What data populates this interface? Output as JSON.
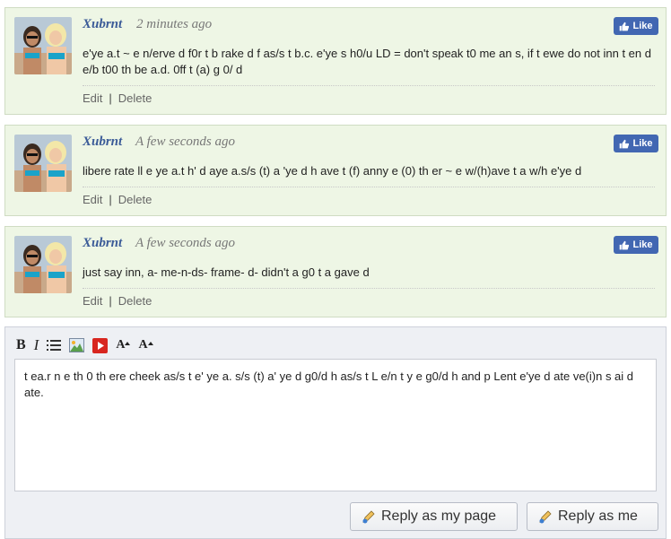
{
  "like_label": "Like",
  "edit_label": "Edit",
  "delete_label": "Delete",
  "separator": "|",
  "comments": [
    {
      "author": "Xubrnt",
      "time": "2 minutes ago",
      "text": "e'ye a.t ~ e n/erve d f0r t b rake d f as/s t b.c. e'ye s h0/u LD = don't speak t0 me an s, if t ewe do not inn t en d e/b t00 th be a.d. 0ff t (a) g 0/ d"
    },
    {
      "author": "Xubrnt",
      "time": "A few seconds ago",
      "text": "libere rate ll e ye a.t h' d aye a.s/s (t) a 'ye d h ave t (f) anny e (0) th er ~ e w/(h)ave t a w/h e'ye d"
    },
    {
      "author": "Xubrnt",
      "time": "A few seconds ago",
      "text": "just say inn, a- me-n-ds- frame- d- didn't a g0 t a gave d"
    }
  ],
  "editor": {
    "toolbar": {
      "bold": "B",
      "italic": "I",
      "font_up": "A",
      "font_down": "A",
      "icons": [
        "bold-icon",
        "italic-icon",
        "list-icon",
        "image-icon",
        "video-icon",
        "font-increase-icon",
        "font-decrease-icon"
      ]
    },
    "content": "t ea.r n e th 0 th ere cheek as/s t e' ye a. s/s (t) a' ye d g0/d h as/s t L e/n t y e g0/d h and p Lent e'ye d ate ve(i)n s ai d ate.",
    "reply_page_label": "Reply as my page",
    "reply_me_label": "Reply as me"
  },
  "colors": {
    "comment_bg": "#eef6e5",
    "author": "#3b5b98",
    "like_bg": "#4267b2",
    "editor_bg": "#eef0f4"
  }
}
